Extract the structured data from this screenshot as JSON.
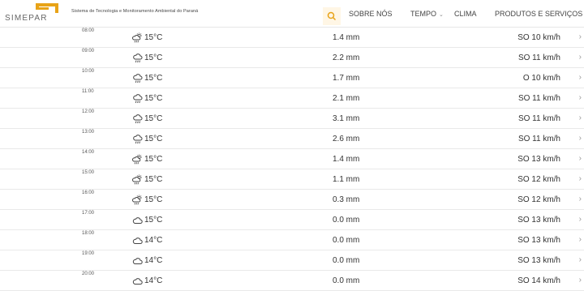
{
  "header": {
    "logo_text": "SIMEPAR",
    "tagline": "Sistema de Tecnologia e Monitoramento Ambiental do Paraná",
    "nav": {
      "sobre": "SOBRE NÓS",
      "tempo": "TEMPO",
      "clima": "CLIMA",
      "produtos": "PRODUTOS E SERVIÇOS"
    },
    "accent_color": "#e8a317"
  },
  "rows": [
    {
      "hour": "08:00",
      "icon": "sun-cloud-rain-icon",
      "temp": "15°C",
      "rain": "1.4 mm",
      "wind": "SO 10 km/h"
    },
    {
      "hour": "09:00",
      "icon": "cloud-rain-icon",
      "temp": "15°C",
      "rain": "2.2 mm",
      "wind": "SO 11 km/h"
    },
    {
      "hour": "10:00",
      "icon": "cloud-rain-icon",
      "temp": "15°C",
      "rain": "1.7 mm",
      "wind": "O 10 km/h"
    },
    {
      "hour": "11:00",
      "icon": "cloud-rain-icon",
      "temp": "15°C",
      "rain": "2.1 mm",
      "wind": "SO 11 km/h"
    },
    {
      "hour": "12:00",
      "icon": "cloud-rain-icon",
      "temp": "15°C",
      "rain": "3.1 mm",
      "wind": "SO 11 km/h"
    },
    {
      "hour": "13:00",
      "icon": "cloud-rain-icon",
      "temp": "15°C",
      "rain": "2.6 mm",
      "wind": "SO 11 km/h"
    },
    {
      "hour": "14:00",
      "icon": "sun-cloud-rain-icon",
      "temp": "15°C",
      "rain": "1.4 mm",
      "wind": "SO 13 km/h"
    },
    {
      "hour": "15:00",
      "icon": "sun-cloud-rain-icon",
      "temp": "15°C",
      "rain": "1.1 mm",
      "wind": "SO 12 km/h"
    },
    {
      "hour": "16:00",
      "icon": "sun-cloud-rain-icon",
      "temp": "15°C",
      "rain": "0.3 mm",
      "wind": "SO 12 km/h"
    },
    {
      "hour": "17:00",
      "icon": "cloud-icon",
      "temp": "15°C",
      "rain": "0.0 mm",
      "wind": "SO 13 km/h"
    },
    {
      "hour": "18:00",
      "icon": "cloud-icon",
      "temp": "14°C",
      "rain": "0.0 mm",
      "wind": "SO 13 km/h"
    },
    {
      "hour": "19:00",
      "icon": "cloud-icon",
      "temp": "14°C",
      "rain": "0.0 mm",
      "wind": "SO 13 km/h"
    },
    {
      "hour": "20:00",
      "icon": "cloud-icon",
      "temp": "14°C",
      "rain": "0.0 mm",
      "wind": "SO 14 km/h"
    }
  ]
}
